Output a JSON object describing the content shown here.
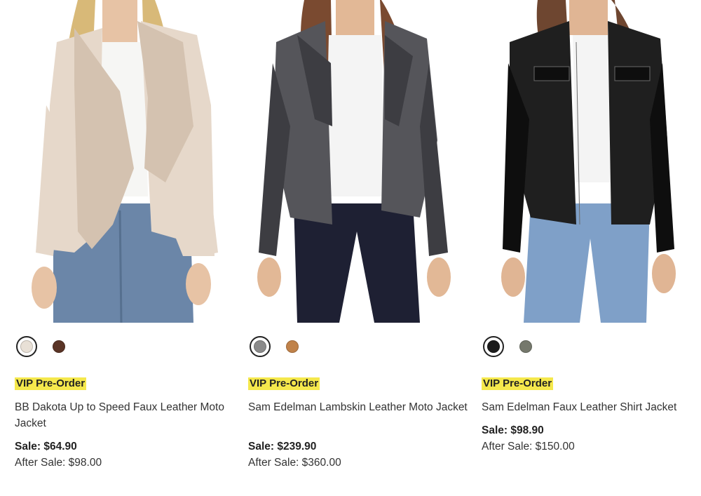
{
  "products": [
    {
      "name": "BB Dakota Up to Speed Faux Leather Moto Jacket",
      "badge": "VIP Pre-Order",
      "sale_price": "Sale: $64.90",
      "after_sale_price": "After Sale: $98.00",
      "image_desc": "model-in-beige-drape-jacket",
      "swatches": [
        {
          "color": "#e8e0d6",
          "selected": true
        },
        {
          "color": "#5a3426",
          "selected": false
        }
      ],
      "jacket_color": "#e6d8ca",
      "jacket_shade": "#d4c2b0"
    },
    {
      "name": "Sam Edelman Lambskin Leather Moto Jacket",
      "badge": "VIP Pre-Order",
      "sale_price": "Sale: $239.90",
      "after_sale_price": "After Sale: $360.00",
      "image_desc": "model-in-gray-leather-moto-jacket",
      "swatches": [
        {
          "color": "#8a8a8a",
          "selected": true
        },
        {
          "color": "#c0824a",
          "selected": false
        }
      ],
      "jacket_color": "#55555a",
      "jacket_shade": "#3d3d42"
    },
    {
      "name": "Sam Edelman Faux Leather Shirt Jacket",
      "badge": "VIP Pre-Order",
      "sale_price": "Sale: $98.90",
      "after_sale_price": "After Sale: $150.00",
      "image_desc": "model-in-black-faux-leather-shirt-jacket",
      "swatches": [
        {
          "color": "#1c1c1c",
          "selected": true
        },
        {
          "color": "#75786c",
          "selected": false
        }
      ],
      "jacket_color": "#1f1f1f",
      "jacket_shade": "#0e0e0e"
    }
  ]
}
